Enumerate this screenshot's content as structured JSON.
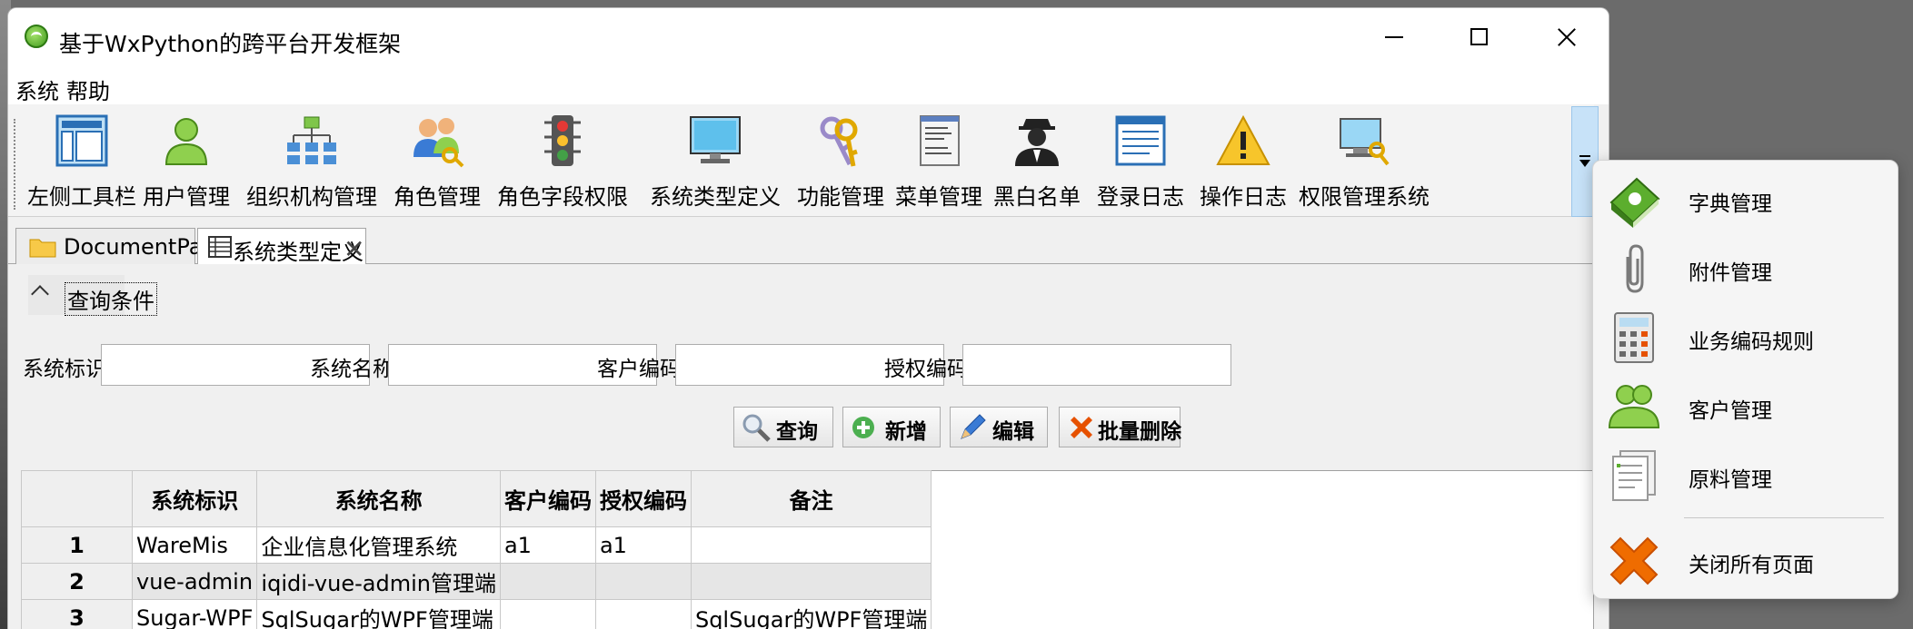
{
  "window": {
    "title": "基于WxPython的跨平台开发框架"
  },
  "menubar": {
    "items": [
      {
        "label": "系统"
      },
      {
        "label": "帮助"
      }
    ]
  },
  "toolbar": {
    "items": [
      {
        "label": "左侧工具栏",
        "icon": "layout-icon"
      },
      {
        "label": "用户管理",
        "icon": "user-icon"
      },
      {
        "label": "组织机构管理",
        "icon": "org-chart-icon"
      },
      {
        "label": "角色管理",
        "icon": "users-key-icon"
      },
      {
        "label": "角色字段权限",
        "icon": "traffic-light-icon"
      },
      {
        "label": "系统类型定义",
        "icon": "monitor-icon"
      },
      {
        "label": "功能管理",
        "icon": "keys-icon"
      },
      {
        "label": "菜单管理",
        "icon": "menu-doc-icon"
      },
      {
        "label": "黑白名单",
        "icon": "agent-icon"
      },
      {
        "label": "登录日志",
        "icon": "log-icon"
      },
      {
        "label": "操作日志",
        "icon": "warning-icon"
      },
      {
        "label": "权限管理系统",
        "icon": "computer-key-icon"
      }
    ]
  },
  "tabs": [
    {
      "label": "DocumentPanel",
      "icon": "folder-icon"
    },
    {
      "label": "系统类型定义",
      "icon": "table-icon",
      "close": "✕"
    }
  ],
  "query": {
    "title": "查询条件",
    "fields": [
      {
        "label": "系统标识:",
        "value": ""
      },
      {
        "label": "系统名称:",
        "value": ""
      },
      {
        "label": "客户编码:",
        "value": ""
      },
      {
        "label": "授权编码:",
        "value": ""
      }
    ],
    "buttons": [
      {
        "label": "查询",
        "icon": "magnifier-icon"
      },
      {
        "label": "新增",
        "icon": "plus-circle-icon"
      },
      {
        "label": "编辑",
        "icon": "pencil-icon"
      },
      {
        "label": "批量删除",
        "icon": "red-x-icon"
      }
    ]
  },
  "grid": {
    "columns": [
      "系统标识",
      "系统名称",
      "客户编码",
      "授权编码",
      "备注"
    ],
    "rows": [
      {
        "n": "1",
        "cells": [
          "WareMis",
          "企业信息化管理系统",
          "a1",
          "a1",
          ""
        ]
      },
      {
        "n": "2",
        "cells": [
          "vue-admin",
          "iqidi-vue-admin管理端",
          "",
          "",
          ""
        ]
      },
      {
        "n": "3",
        "cells": [
          "Sugar-WPF",
          "SqlSugar的WPF管理端",
          "",
          "",
          "SqlSugar的WPF管理端"
        ]
      }
    ]
  },
  "dropdown": {
    "items": [
      {
        "label": "字典管理",
        "icon": "dictionary-book-icon"
      },
      {
        "label": "附件管理",
        "icon": "paperclip-icon"
      },
      {
        "label": "业务编码规则",
        "icon": "calculator-icon"
      },
      {
        "label": "客户管理",
        "icon": "customers-icon"
      },
      {
        "label": "原料管理",
        "icon": "documents-icon"
      },
      {
        "label": "关闭所有页面",
        "icon": "close-all-icon"
      }
    ]
  }
}
